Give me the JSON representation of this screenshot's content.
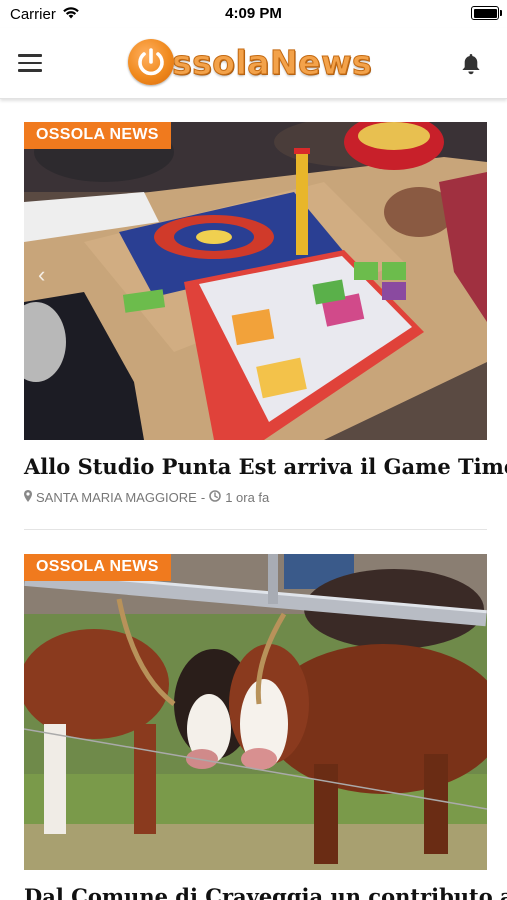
{
  "status_bar": {
    "carrier": "Carrier",
    "time": "4:09 PM"
  },
  "header": {
    "logo_text": "ssolaNews",
    "logo_color": "#f08a1e"
  },
  "articles": [
    {
      "category": "OSSOLA NEWS",
      "title": "Allo Studio Punta Est arriva il Game Time",
      "location": "SANTA MARIA MAGGIORE",
      "separator": "-",
      "time": "1 ora fa"
    },
    {
      "category": "OSSOLA NEWS",
      "title": "Dal Comune di Craveggia un contributo al"
    }
  ],
  "colors": {
    "accent": "#f07a1e",
    "meta_text": "#777777",
    "title_text": "#111111"
  },
  "icons": [
    "menu-icon",
    "power-icon",
    "bell-icon",
    "wifi-icon",
    "battery-icon",
    "map-marker-icon",
    "clock-icon",
    "chevron-left-icon"
  ]
}
